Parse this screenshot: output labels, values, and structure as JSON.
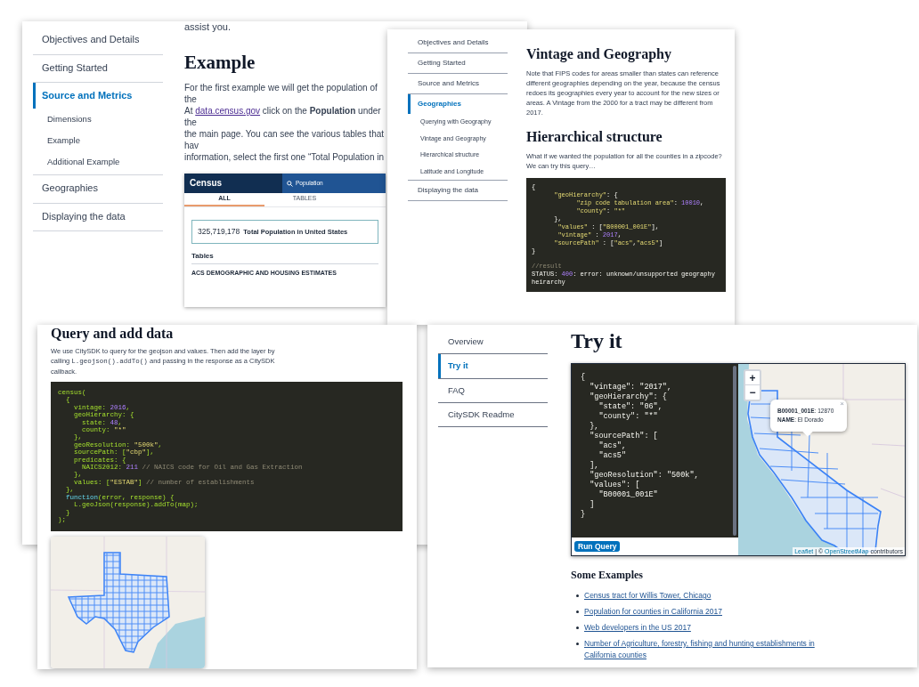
{
  "page_example": {
    "sidebar": [
      {
        "label": "Objectives and Details",
        "selected": false
      },
      {
        "label": "Getting Started",
        "selected": false
      },
      {
        "label": "Source and Metrics",
        "selected": true,
        "children": [
          {
            "label": "Dimensions",
            "selected": false
          },
          {
            "label": "Example",
            "selected": false
          },
          {
            "label": "Additional Example",
            "selected": false
          }
        ]
      },
      {
        "label": "Geographies",
        "selected": false
      },
      {
        "label": "Displaying the data",
        "selected": false
      }
    ],
    "intro_text": "assist you.",
    "heading": "Example",
    "paragraph_lines": [
      {
        "text": "For the first example we will get the population of the"
      },
      {
        "text": "At ",
        "link": "data.census.gov",
        "rest": " click on the **Population** under the"
      },
      {
        "text": "the main page. You can see the various tables that hav"
      },
      {
        "text": "information, select the first one “Total Population in"
      }
    ],
    "screenshot": {
      "logo": "Census",
      "search": "Population",
      "tabs": [
        {
          "label": "ALL",
          "selected": true
        },
        {
          "label": "TABLES",
          "selected": false
        }
      ],
      "total": "325,719,178",
      "total_label": "Total Population in United States",
      "tables_heading": "Tables",
      "table_title": "ACS DEMOGRAPHIC AND HOUSING ESTIMATES"
    }
  },
  "page_geography": {
    "sidebar": [
      {
        "label": "Objectives and Details",
        "selected": false
      },
      {
        "label": "Getting Started",
        "selected": false
      },
      {
        "label": "Source and Metrics",
        "selected": false
      },
      {
        "label": "Geographies",
        "selected": true,
        "children": [
          {
            "label": "Querying with Geography",
            "selected": false
          },
          {
            "label": "Vintage and Geography",
            "selected": false
          },
          {
            "label": "Hierarchical structure",
            "selected": false
          },
          {
            "label": "Latitude and Longitude",
            "selected": false
          }
        ]
      },
      {
        "label": "Displaying the data",
        "selected": false
      }
    ],
    "heading": "Vintage and Geography",
    "paragraph": "Note that FIPS codes for areas smaller than states can reference different geographies depending on the year, because the census redoes its geographies every year to account for the new sizes or areas. A Vintage from the 2000 for a tract may be different from 2017.",
    "heading_2": "Hierarchical structure",
    "paragraph_2": "What if we wanted the population for all the counties in a zipcode? We can try this query…",
    "code": {
      "kind": "json",
      "lines": [
        "{",
        "      \"geoHierarchy\": {",
        "            \"zip code tabulation area\": 10010,",
        "            \"county\": \"*\"",
        "      },",
        "       \"values\" : [\"B00001_001E\"],",
        "       \"vintage\" : 2017,",
        "      \"sourcePath\" : [\"acs\",\"acs5\"]",
        "}"
      ],
      "result_lines": [
        "//result",
        "STATUS: 400: error: unknown/unsupported geography heirarchy"
      ]
    }
  },
  "page_query": {
    "heading": "Query and add data",
    "paragraph": {
      "before": "We use CitySDK to query for the geojson and values. Then add the layer by calling ",
      "code": "L.geojson().addTo()",
      "after": " and passing in the response as a CitySDK callback."
    },
    "code": {
      "kind": "js",
      "lines": [
        "census(",
        "  {",
        "    vintage: 2016,",
        "    geoHierarchy: {",
        "      state: 48,",
        "      county: \"*\"",
        "    },",
        "    geoResolution: \"500k\",",
        "    sourcePath: [\"cbp\"],",
        "    predicates: {",
        "      NAICS2012: 211 // NAICS code for Oil and Gas Extraction",
        "    },",
        "    values: [\"ESTAB\"] // number of establishments",
        "  },",
        "  function(error, response) {",
        "    L.geoJson(response).addTo(map);",
        "  }",
        ");"
      ]
    }
  },
  "page_try_it": {
    "sidebar": [
      {
        "label": "Overview",
        "selected": false
      },
      {
        "label": "Try it",
        "selected": true
      },
      {
        "label": "FAQ",
        "selected": false
      },
      {
        "label": "CitySDK Readme",
        "selected": false
      }
    ],
    "heading": "Try it",
    "code": {
      "kind": "plain",
      "lines": [
        "{",
        "  \"vintage\": \"2017\",",
        "  \"geoHierarchy\": {",
        "    \"state\": \"06\",",
        "    \"county\": \"*\"",
        "  },",
        "  \"sourcePath\": [",
        "    \"acs\",",
        "    \"acs5\"",
        "  ],",
        "  \"geoResolution\": \"500k\",",
        "  \"values\": [",
        "    \"B00001_001E\"",
        "  ]",
        "}"
      ]
    },
    "run_button": "Run Query",
    "map": {
      "zoom_in": "+",
      "zoom_out": "−",
      "popup_lines": [
        "**B00001_001E**: 12870",
        "**NAME**: El Dorado"
      ],
      "popup_close": "×",
      "attribution": {
        "leaflet": "Leaflet",
        "middle": " | © ",
        "osm": "OpenStreetMap",
        "tail": " contributors"
      }
    },
    "examples_heading": "Some Examples",
    "examples": [
      "Census tract for Willis Tower, Chicago",
      "Population for counties in California 2017",
      "Web developers in the US 2017",
      "Number of Agriculture, forestry, fishing and hunting establishments in California counties"
    ]
  }
}
